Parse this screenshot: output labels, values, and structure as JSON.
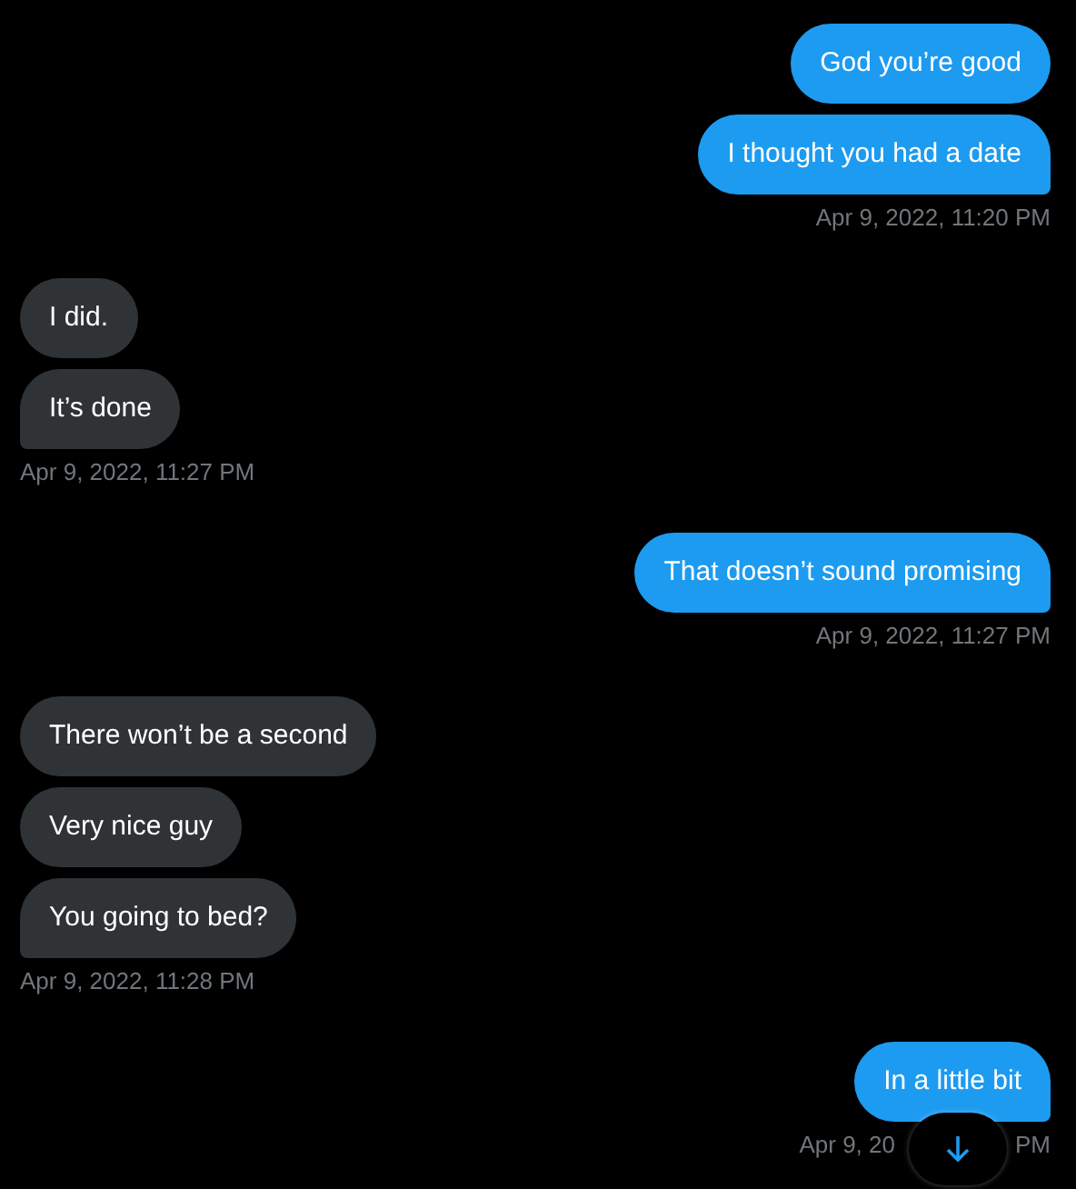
{
  "conversation": [
    {
      "kind": "sent",
      "messages": [
        "God you’re good",
        "I thought you had a date"
      ],
      "timestamp": [
        "Apr 9, 2022, 11:20 PM"
      ]
    },
    {
      "kind": "received",
      "messages": [
        "I did.",
        "It’s done"
      ],
      "timestamp": [
        "Apr 9, 2022, 11:27 PM"
      ]
    },
    {
      "kind": "sent",
      "messages": [
        "That doesn’t sound promising"
      ],
      "timestamp": [
        "Apr 9, 2022, 11:27 PM"
      ]
    },
    {
      "kind": "received",
      "messages": [
        "There won’t be a second",
        "Very nice guy",
        "You going to bed?"
      ],
      "timestamp": [
        "Apr 9, 2022, 11:28 PM"
      ]
    },
    {
      "kind": "sent",
      "messages": [
        "In a little bit"
      ],
      "timestamp": [
        "Apr 9, 20",
        "PM"
      ]
    }
  ]
}
